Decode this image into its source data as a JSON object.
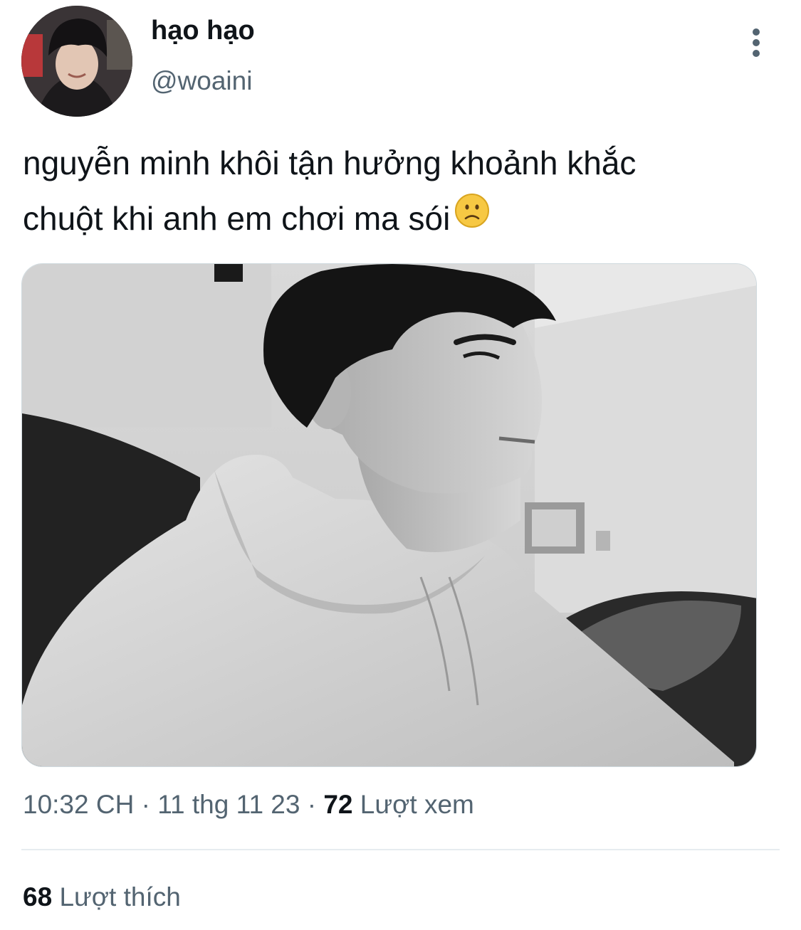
{
  "author": {
    "display_name": "hạo hạo",
    "handle": "@woaini"
  },
  "icons": {
    "more": "more-vertical-icon",
    "emoji": "slightly-frowning-face-icon"
  },
  "tweet": {
    "line1": "nguyễn minh khôi tận hưởng khoảnh khắc",
    "line2": "chuột khi anh em chơi ma sói"
  },
  "meta": {
    "time": "10:32 CH",
    "separator": "·",
    "date": "11 thg 11 23",
    "views_count": "72",
    "views_label": "Lượt xem"
  },
  "stats": {
    "likes_count": "68",
    "likes_label": "Lượt thích"
  },
  "colors": {
    "text_primary": "#0f1419",
    "text_secondary": "#536471",
    "divider": "#e6ecf0"
  }
}
